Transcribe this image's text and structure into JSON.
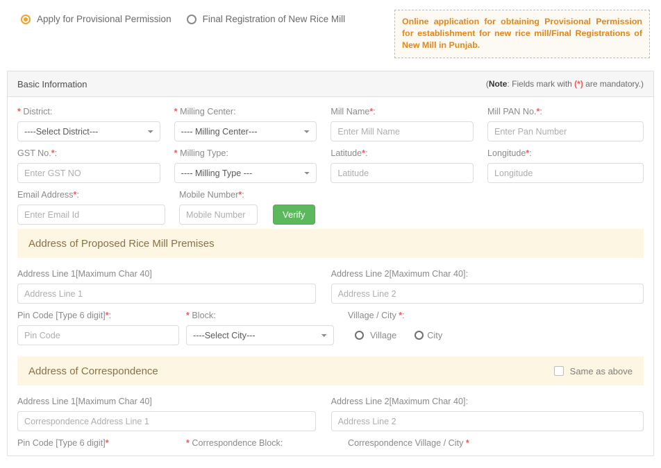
{
  "top": {
    "options": [
      {
        "label": "Apply for Provisional Permission",
        "selected": true
      },
      {
        "label": "Final Registration of New Rice Mill",
        "selected": false
      }
    ],
    "notice": "Online application for obtaining Provisional Permission for establishment for new rice mill/Final Registrations of New Mill in Punjab.",
    "notice_color": "#e2861b"
  },
  "basic": {
    "title": "Basic Information",
    "note_prefix": "(",
    "note_bold": "Note",
    "note_mid": ": Fields mark with ",
    "note_ast": "(*)",
    "note_suffix": " are mandatory.)",
    "fields": {
      "district": {
        "label": "District:",
        "ast": "*",
        "ast_before": true,
        "value": "----Select District---"
      },
      "milling_center": {
        "label": "Milling Center:",
        "ast": "*",
        "ast_before": true,
        "value": "---- Milling Center---"
      },
      "mill_name": {
        "label": "Mill Name",
        "ast": "*",
        "tail": ":",
        "placeholder": "Enter Mill Name"
      },
      "mill_pan": {
        "label": "Mill PAN No.",
        "ast": "*",
        "tail": ":",
        "placeholder": "Enter Pan Number"
      },
      "gst_no": {
        "label": "GST No.",
        "ast": "*",
        "tail": ":",
        "placeholder": "Enter GST NO"
      },
      "milling_type": {
        "label": "Milling Type:",
        "ast": "*",
        "ast_before": true,
        "value": "---- Milling Type ---"
      },
      "latitude": {
        "label": "Latitude",
        "ast": "*",
        "tail": ":",
        "placeholder": "Latitude"
      },
      "longitude": {
        "label": "Longitude",
        "ast": "*",
        "tail": ":",
        "placeholder": "Longitude"
      },
      "email": {
        "label": "Email Address",
        "ast": "*",
        "tail": ":",
        "placeholder": "Enter Email Id"
      },
      "mobile": {
        "label": "Mobile Number",
        "ast": "*",
        "tail": ":",
        "placeholder": "Mobile Number"
      },
      "verify_button": "Verify",
      "verify_color": "#5cb85c"
    }
  },
  "premises": {
    "title": "Address of Proposed Rice Mill Premises",
    "address_line1_label": "Address Line 1[Maximum Char 40]",
    "address_line1_placeholder": "Address Line 1",
    "address_line2_label": "Address Line 2[Maximum Char 40]:",
    "address_line2_placeholder": "Address Line 2",
    "pincode_label": "Pin Code [Type 6 digit]",
    "pincode_ast": "*",
    "pincode_tail": ":",
    "pincode_placeholder": "Pin Code",
    "block_label": "Block:",
    "block_ast": "*",
    "block_value": "----Select City---",
    "village_city_label": "Village / City ",
    "village_city_ast": "*",
    "village_city_tail": ":",
    "village_option": "Village",
    "city_option": "City"
  },
  "correspondence": {
    "title": "Address of Correspondence",
    "same_as_above": "Same as above",
    "address_line1_label": "Address Line 1[Maximum Char 40]",
    "address_line1_placeholder": "Correspondence Address Line 1",
    "address_line2_label": "Address Line 2[Maximum Char 40]:",
    "address_line2_placeholder": "Address Line 2",
    "pincode_label": "Pin Code [Type 6 digit]",
    "pincode_ast": "*",
    "block_label": "Correspondence Block:",
    "block_ast": "*",
    "village_city_label": "Correspondence Village / City ",
    "village_city_ast": "*"
  }
}
